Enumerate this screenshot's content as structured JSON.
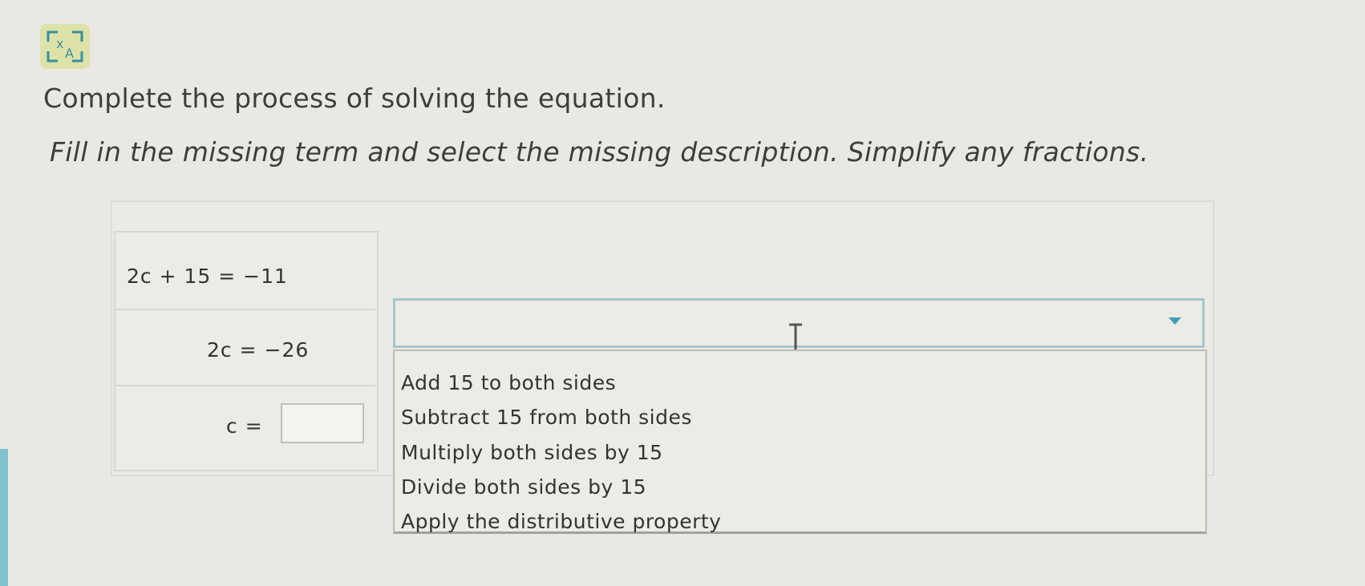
{
  "header": {
    "icon": "translate-icon",
    "instruction": "Complete the process of solving the equation.",
    "direction": "Fill in the missing term and select the missing description. Simplify any fractions."
  },
  "steps": [
    {
      "text": "2c + 15 = −11"
    },
    {
      "text": "2c = −26"
    },
    {
      "text": "c ="
    }
  ],
  "answer_input": {
    "value": ""
  },
  "description_select": {
    "selected": "",
    "options": [
      "Add 15 to both sides",
      "Subtract 15 from both sides",
      "Multiply both sides by 15",
      "Divide both sides by 15",
      "Apply the distributive property"
    ]
  },
  "colors": {
    "background": "#e9e8e3",
    "select_border": "#a7c6ca",
    "icon_background": "#dde3a8",
    "icon_stroke": "#3a8f9e"
  }
}
